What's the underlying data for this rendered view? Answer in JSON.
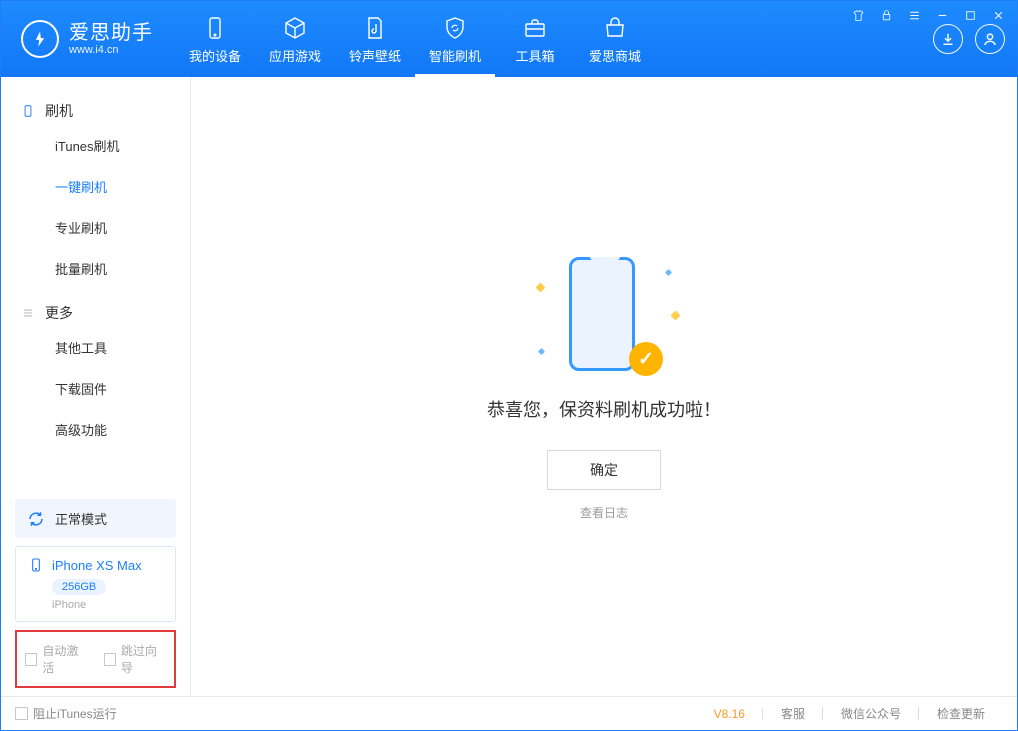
{
  "app": {
    "name_cn": "爱思助手",
    "name_en": "www.i4.cn"
  },
  "tabs": [
    {
      "label": "我的设备"
    },
    {
      "label": "应用游戏"
    },
    {
      "label": "铃声壁纸"
    },
    {
      "label": "智能刷机"
    },
    {
      "label": "工具箱"
    },
    {
      "label": "爱思商城"
    }
  ],
  "sidebar": {
    "group1": "刷机",
    "items1": [
      "iTunes刷机",
      "一键刷机",
      "专业刷机",
      "批量刷机"
    ],
    "group2": "更多",
    "items2": [
      "其他工具",
      "下载固件",
      "高级功能"
    ]
  },
  "mode": {
    "label": "正常模式"
  },
  "device": {
    "name": "iPhone XS Max",
    "capacity": "256GB",
    "type": "iPhone"
  },
  "options": {
    "auto_activate": "自动激活",
    "skip_guide": "跳过向导"
  },
  "main": {
    "success_title": "恭喜您，保资料刷机成功啦！",
    "ok_button": "确定",
    "view_log": "查看日志"
  },
  "status": {
    "block_itunes": "阻止iTunes运行",
    "version": "V8.16",
    "links": [
      "客服",
      "微信公众号",
      "检查更新"
    ]
  }
}
